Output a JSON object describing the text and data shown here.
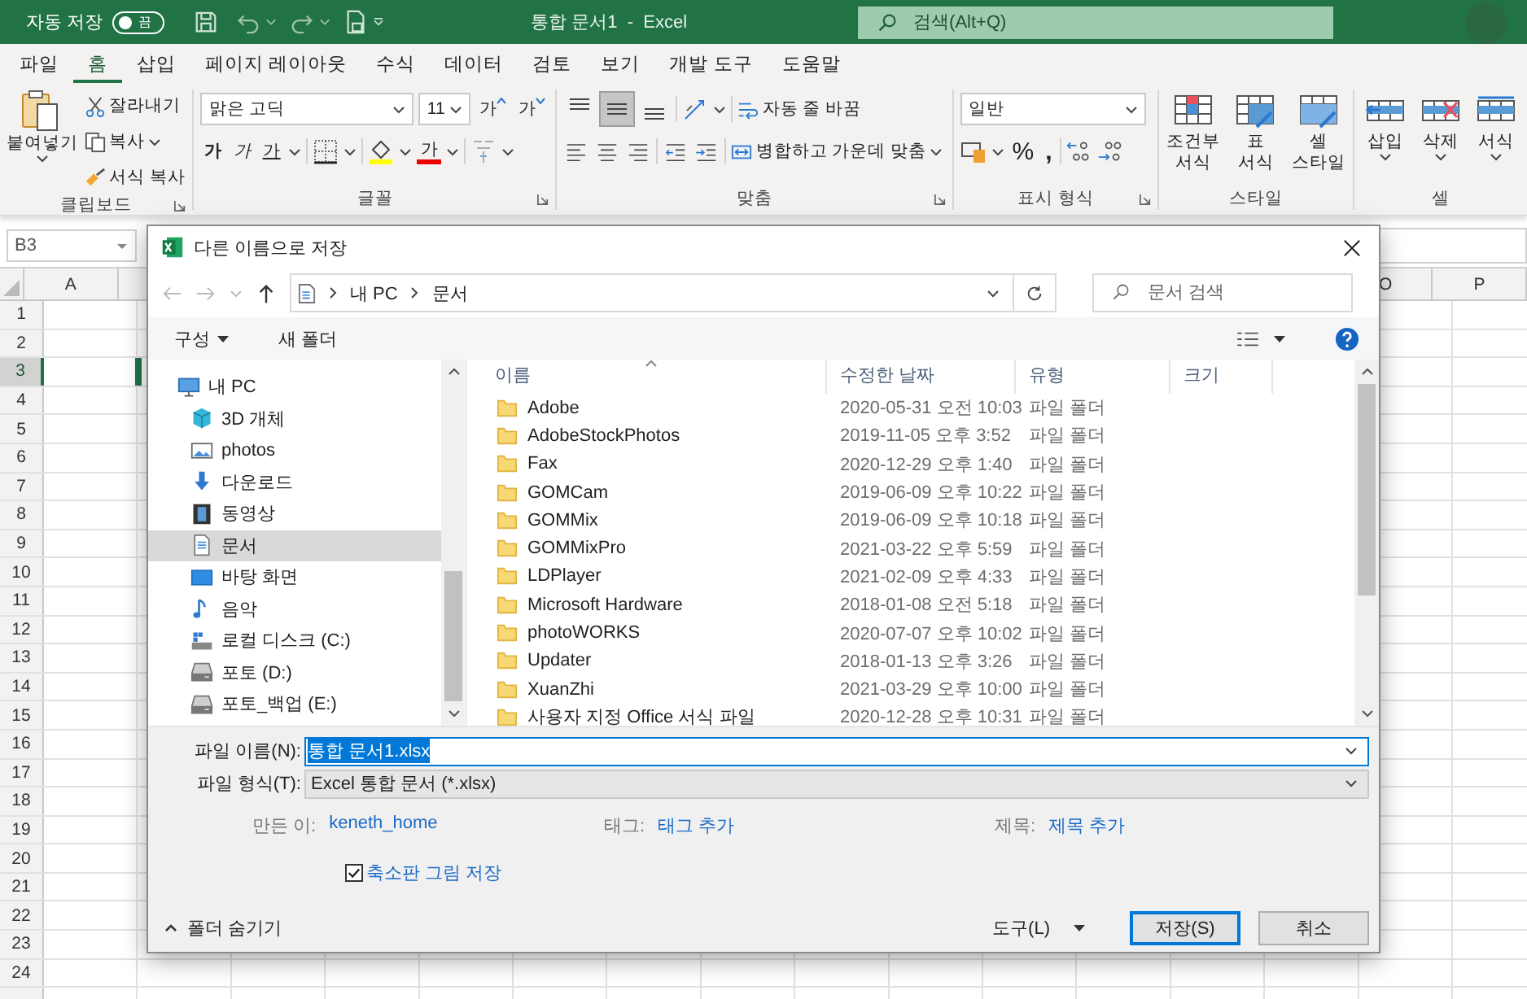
{
  "titlebar": {
    "autosave_label": "자동 저장",
    "autosave": {
      "on": false,
      "label": "끔"
    },
    "title": "통합 문서1  -  Excel",
    "search": {
      "placeholder": "검색(Alt+Q)"
    }
  },
  "tabs": [
    {
      "label": "파일",
      "selected": false
    },
    {
      "label": "홈",
      "selected": true
    },
    {
      "label": "삽입",
      "selected": false
    },
    {
      "label": "페이지 레이아웃",
      "selected": false
    },
    {
      "label": "수식",
      "selected": false
    },
    {
      "label": "데이터",
      "selected": false
    },
    {
      "label": "검토",
      "selected": false
    },
    {
      "label": "보기",
      "selected": false
    },
    {
      "label": "개발 도구",
      "selected": false
    },
    {
      "label": "도움말",
      "selected": false
    }
  ],
  "ribbon": {
    "clipboard": {
      "paste": "붙여넣기",
      "cut": "잘라내기",
      "copy": "복사",
      "format_painter": "서식 복사",
      "label": "클립보드"
    },
    "font": {
      "name": "맑은 고딕",
      "size": "11",
      "grow": "가",
      "shrink": "가",
      "bold": "가",
      "italic": "가",
      "underline": "가",
      "font_color": "가",
      "label": "글꼴"
    },
    "alignment": {
      "valign": [
        {
          "selected": false
        },
        {
          "selected": true
        },
        {
          "selected": false
        }
      ],
      "wrap": "자동 줄 바꿈",
      "merge": "병합하고 가운데 맞춤",
      "label": "맞춤"
    },
    "number": {
      "format": "일반",
      "percent": "%",
      "comma": ",",
      "label": "표시 형식"
    },
    "styles": {
      "buttons": [
        {
          "kind": "conditional",
          "lines": [
            "조건부",
            "서식"
          ]
        },
        {
          "kind": "table",
          "lines": [
            "표",
            "서식"
          ]
        },
        {
          "kind": "cell",
          "lines": [
            "셀",
            "스타일"
          ]
        }
      ],
      "label": "스타일"
    },
    "cells": {
      "buttons": [
        {
          "kind": "insert",
          "label": "삽입"
        },
        {
          "kind": "delete",
          "label": "삭제"
        },
        {
          "kind": "format",
          "label": "서식"
        }
      ],
      "label": "셀"
    }
  },
  "name_box": "B3",
  "sheet": {
    "columns": [
      "A",
      "O",
      "P"
    ],
    "rows": [
      {
        "label": "1",
        "selected": false
      },
      {
        "label": "2",
        "selected": false
      },
      {
        "label": "3",
        "selected": true
      },
      {
        "label": "4",
        "selected": false
      },
      {
        "label": "5",
        "selected": false
      },
      {
        "label": "6",
        "selected": false
      },
      {
        "label": "7",
        "selected": false
      },
      {
        "label": "8",
        "selected": false
      },
      {
        "label": "9",
        "selected": false
      },
      {
        "label": "10",
        "selected": false
      },
      {
        "label": "11",
        "selected": false
      },
      {
        "label": "12",
        "selected": false
      },
      {
        "label": "13",
        "selected": false
      },
      {
        "label": "14",
        "selected": false
      },
      {
        "label": "15",
        "selected": false
      },
      {
        "label": "16",
        "selected": false
      },
      {
        "label": "17",
        "selected": false
      },
      {
        "label": "18",
        "selected": false
      },
      {
        "label": "19",
        "selected": false
      },
      {
        "label": "20",
        "selected": false
      },
      {
        "label": "21",
        "selected": false
      },
      {
        "label": "22",
        "selected": false
      },
      {
        "label": "23",
        "selected": false
      },
      {
        "label": "24",
        "selected": false
      }
    ]
  },
  "dialog": {
    "title": "다른 이름으로 저장",
    "breadcrumb": [
      "내 PC",
      "문서"
    ],
    "search": {
      "placeholder": "문서 검색"
    },
    "toolbar": {
      "organize": "구성",
      "new_folder": "새 폴더"
    },
    "nav": [
      {
        "label": "내 PC",
        "kind": "pc",
        "selected": false,
        "children": [
          {
            "label": "3D 개체",
            "kind": "cube",
            "selected": false
          },
          {
            "label": "photos",
            "kind": "picture",
            "selected": false
          },
          {
            "label": "다운로드",
            "kind": "download",
            "selected": false
          },
          {
            "label": "동영상",
            "kind": "video",
            "selected": false
          },
          {
            "label": "문서",
            "kind": "document",
            "selected": true
          },
          {
            "label": "바탕 화면",
            "kind": "desktop",
            "selected": false
          },
          {
            "label": "음악",
            "kind": "music",
            "selected": false
          },
          {
            "label": "로컬 디스크 (C:)",
            "kind": "system-drive",
            "selected": false
          },
          {
            "label": "포토 (D:)",
            "kind": "drive",
            "selected": false
          },
          {
            "label": "포토_백업 (E:)",
            "kind": "drive",
            "selected": false
          }
        ]
      }
    ],
    "files": {
      "columns": [
        "이름",
        "수정한 날짜",
        "유형",
        "크기"
      ],
      "rows": [
        {
          "name": "Adobe",
          "modified": "2020-05-31 오전 10:03",
          "type": "파일 폴더"
        },
        {
          "name": "AdobeStockPhotos",
          "modified": "2019-11-05 오후 3:52",
          "type": "파일 폴더"
        },
        {
          "name": "Fax",
          "modified": "2020-12-29 오후 1:40",
          "type": "파일 폴더"
        },
        {
          "name": "GOMCam",
          "modified": "2019-06-09 오후 10:22",
          "type": "파일 폴더"
        },
        {
          "name": "GOMMix",
          "modified": "2019-06-09 오후 10:18",
          "type": "파일 폴더"
        },
        {
          "name": "GOMMixPro",
          "modified": "2021-03-22 오후 5:59",
          "type": "파일 폴더"
        },
        {
          "name": "LDPlayer",
          "modified": "2021-02-09 오후 4:33",
          "type": "파일 폴더"
        },
        {
          "name": "Microsoft Hardware",
          "modified": "2018-01-08 오전 5:18",
          "type": "파일 폴더"
        },
        {
          "name": "photoWORKS",
          "modified": "2020-07-07 오후 10:02",
          "type": "파일 폴더"
        },
        {
          "name": "Updater",
          "modified": "2018-01-13 오후 3:26",
          "type": "파일 폴더"
        },
        {
          "name": "XuanZhi",
          "modified": "2021-03-29 오후 10:00",
          "type": "파일 폴더"
        },
        {
          "name": "사용자 지정 Office 서식 파일",
          "modified": "2020-12-28 오후 10:31",
          "type": "파일 폴더"
        }
      ]
    },
    "filename": {
      "label": "파일 이름(N):",
      "value": "통합 문서1.xlsx"
    },
    "filetype": {
      "label": "파일 형식(T):",
      "value": "Excel 통합 문서 (*.xlsx)"
    },
    "meta": [
      {
        "label": "만든 이:",
        "value": "keneth_home"
      },
      {
        "label": "태그:",
        "value": "태그 추가"
      },
      {
        "label": "제목:",
        "value": "제목 추가"
      }
    ],
    "thumbnail": {
      "label": "축소판 그림 저장",
      "checked": true
    },
    "hide_folders": "폴더 숨기기",
    "tools": "도구(L)",
    "save": "저장(S)",
    "cancel": "취소"
  }
}
